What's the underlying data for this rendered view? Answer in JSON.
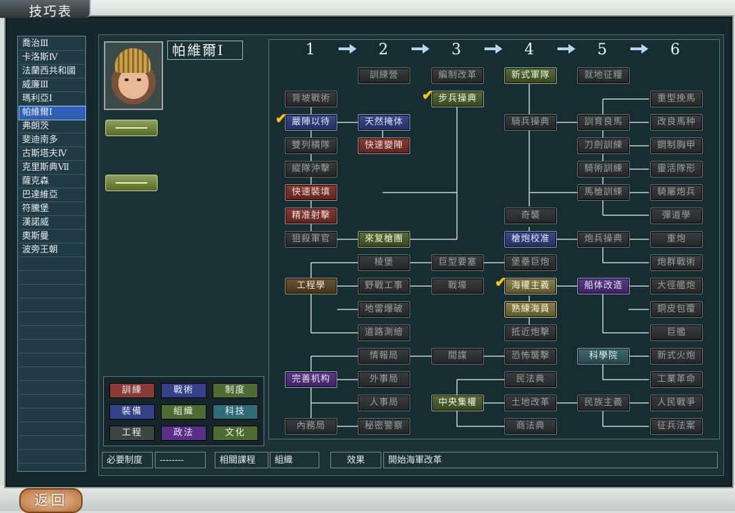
{
  "window": {
    "title": "技巧表"
  },
  "nations": [
    "喬治Ⅲ",
    "卡洛斯Ⅳ",
    "法蘭西共和國",
    "威廉Ⅲ",
    "瑪利亞Ⅰ",
    "帕維爾Ⅰ",
    "弗朗茨",
    "斐迪南多",
    "古斯塔夫Ⅳ",
    "克里斯典Ⅶ",
    "薩克森",
    "巴達維亞",
    "符騰堡",
    "漢諾威",
    "奧斯曼",
    "波旁王朝"
  ],
  "selected_nation_index": 5,
  "ruler": {
    "name": "帕維爾Ⅰ"
  },
  "columns": [
    "1",
    "2",
    "3",
    "4",
    "5",
    "6"
  ],
  "techs": [
    {
      "id": "t01",
      "label": "訓練營",
      "style": "gray"
    },
    {
      "id": "t02",
      "label": "編制改革",
      "style": "gray"
    },
    {
      "id": "t03",
      "label": "新式軍隊",
      "style": "green"
    },
    {
      "id": "t04",
      "label": "就地征糧",
      "style": "gray"
    },
    {
      "id": "t05",
      "label": "背坡戰術",
      "style": "gray"
    },
    {
      "id": "t06",
      "label": "步兵操典",
      "style": "green",
      "checked": true
    },
    {
      "id": "t07",
      "label": "重型挽馬",
      "style": "gray"
    },
    {
      "id": "t08",
      "label": "嚴陣以待",
      "style": "blue",
      "checked": true
    },
    {
      "id": "t09",
      "label": "天然掩体",
      "style": "blue"
    },
    {
      "id": "t10",
      "label": "騎兵操典",
      "style": "gray"
    },
    {
      "id": "t11",
      "label": "訓育良馬",
      "style": "gray"
    },
    {
      "id": "t12",
      "label": "改良馬种",
      "style": "gray"
    },
    {
      "id": "t13",
      "label": "雙列横隊",
      "style": "gray"
    },
    {
      "id": "t14",
      "label": "快速變陣",
      "style": "red"
    },
    {
      "id": "t15",
      "label": "刀劍訓練",
      "style": "gray"
    },
    {
      "id": "t16",
      "label": "鋼制胸甲",
      "style": "gray"
    },
    {
      "id": "t17",
      "label": "縱隊沖擊",
      "style": "gray"
    },
    {
      "id": "t18",
      "label": "騎術訓練",
      "style": "gray"
    },
    {
      "id": "t19",
      "label": "靈活隊形",
      "style": "gray"
    },
    {
      "id": "t20",
      "label": "快速裝填",
      "style": "red"
    },
    {
      "id": "t21",
      "label": "馬槍訓練",
      "style": "gray"
    },
    {
      "id": "t22",
      "label": "騎屬炮兵",
      "style": "gray"
    },
    {
      "id": "t23",
      "label": "精准射擊",
      "style": "red"
    },
    {
      "id": "t24",
      "label": "奇襲",
      "style": "gray"
    },
    {
      "id": "t25",
      "label": "彈道學",
      "style": "gray"
    },
    {
      "id": "t26",
      "label": "狙殺軍官",
      "style": "gray"
    },
    {
      "id": "t27",
      "label": "來复槍團",
      "style": "green"
    },
    {
      "id": "t28",
      "label": "槍炮校准",
      "style": "blue"
    },
    {
      "id": "t29",
      "label": "炮兵操典",
      "style": "gray"
    },
    {
      "id": "t30",
      "label": "重炮",
      "style": "gray"
    },
    {
      "id": "t31",
      "label": "棱堡",
      "style": "gray"
    },
    {
      "id": "t32",
      "label": "巨型要塞",
      "style": "gray"
    },
    {
      "id": "t33",
      "label": "堡壘巨炮",
      "style": "gray"
    },
    {
      "id": "t34",
      "label": "炮群戰術",
      "style": "gray"
    },
    {
      "id": "t35",
      "label": "工程學",
      "style": "brown"
    },
    {
      "id": "t36",
      "label": "野戰工事",
      "style": "gray"
    },
    {
      "id": "t37",
      "label": "戰壕",
      "style": "gray"
    },
    {
      "id": "t38",
      "label": "海權主義",
      "style": "gold",
      "checked": true
    },
    {
      "id": "t39",
      "label": "船体改造",
      "style": "purple"
    },
    {
      "id": "t40",
      "label": "大徑艦炮",
      "style": "gray"
    },
    {
      "id": "t41",
      "label": "地雷爆破",
      "style": "gray"
    },
    {
      "id": "t42",
      "label": "熟練海員",
      "style": "gold"
    },
    {
      "id": "t43",
      "label": "銅皮包覆",
      "style": "gray"
    },
    {
      "id": "t44",
      "label": "道路測繪",
      "style": "gray"
    },
    {
      "id": "t45",
      "label": "抵近炮擊",
      "style": "gray"
    },
    {
      "id": "t46",
      "label": "巨艦",
      "style": "gray"
    },
    {
      "id": "t47",
      "label": "情報局",
      "style": "gray"
    },
    {
      "id": "t48",
      "label": "間諜",
      "style": "gray"
    },
    {
      "id": "t49",
      "label": "恐怖襲擊",
      "style": "gray"
    },
    {
      "id": "t50",
      "label": "科學院",
      "style": "teal"
    },
    {
      "id": "t51",
      "label": "新式火炮",
      "style": "gray"
    },
    {
      "id": "t52",
      "label": "完善机构",
      "style": "purple"
    },
    {
      "id": "t53",
      "label": "外事局",
      "style": "gray"
    },
    {
      "id": "t54",
      "label": "民法典",
      "style": "gray"
    },
    {
      "id": "t55",
      "label": "工業革命",
      "style": "gray"
    },
    {
      "id": "t56",
      "label": "人事局",
      "style": "gray"
    },
    {
      "id": "t57",
      "label": "中央集權",
      "style": "green"
    },
    {
      "id": "t58",
      "label": "土地改革",
      "style": "gray"
    },
    {
      "id": "t59",
      "label": "民族主義",
      "style": "gray"
    },
    {
      "id": "t60",
      "label": "人民戰爭",
      "style": "gray"
    },
    {
      "id": "t61",
      "label": "內務局",
      "style": "gray"
    },
    {
      "id": "t62",
      "label": "秘密警察",
      "style": "gray"
    },
    {
      "id": "t63",
      "label": "商法典",
      "style": "gray"
    },
    {
      "id": "t64",
      "label": "征兵法案",
      "style": "gray"
    }
  ],
  "legend": [
    {
      "label": "訓練",
      "style": "red"
    },
    {
      "label": "戰術",
      "style": "blue"
    },
    {
      "label": "制度",
      "style": "green"
    },
    {
      "label": "裝備",
      "style": "blue"
    },
    {
      "label": "組織",
      "style": "green"
    },
    {
      "label": "科技",
      "style": "teal"
    },
    {
      "label": "工程",
      "style": "gray"
    },
    {
      "label": "政法",
      "style": "purple"
    },
    {
      "label": "文化",
      "style": "green"
    }
  ],
  "legend_colors": {
    "red": "#8a3b35",
    "blue": "#33428a",
    "green": "#4f6b34",
    "teal": "#2e6d78",
    "gray": "#3e4644",
    "purple": "#5a2f8a"
  },
  "bottom": {
    "required_label": "必要制度",
    "required_value": "--------",
    "related_label": "相關課程",
    "related_value": "組織",
    "effect_label": "效果",
    "effect_value": "開始海軍改革"
  },
  "back_button": "返回",
  "check_color": "#f5c61b"
}
